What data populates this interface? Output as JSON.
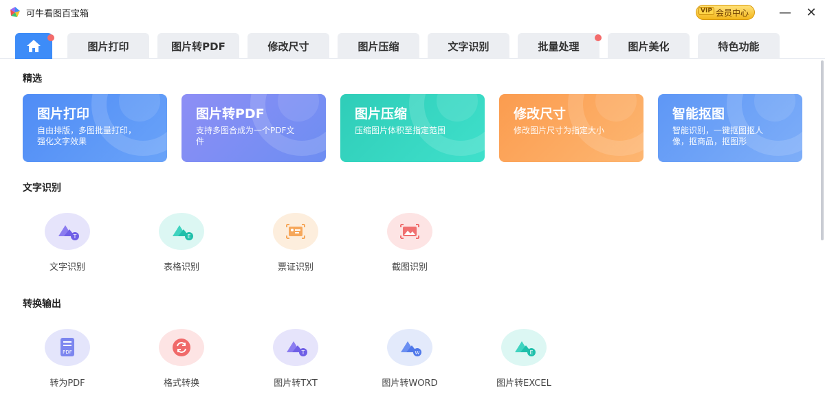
{
  "app": {
    "title": "可牛看图百宝箱",
    "vip_label": "会员中心",
    "vip_badge": "VIP"
  },
  "window": {
    "minimize": "—",
    "close": "✕"
  },
  "tabs": [
    {
      "label": "",
      "icon": "home-icon",
      "active": true,
      "dot": true
    },
    {
      "label": "图片打印"
    },
    {
      "label": "图片转PDF"
    },
    {
      "label": "修改尺寸"
    },
    {
      "label": "图片压缩"
    },
    {
      "label": "文字识别"
    },
    {
      "label": "批量处理",
      "dot": true
    },
    {
      "label": "图片美化"
    },
    {
      "label": "特色功能"
    }
  ],
  "featured": {
    "title": "精选",
    "cards": [
      {
        "title": "图片打印",
        "desc": "自由排版，多图批量打印，强化文字效果",
        "color": "#5e96f6"
      },
      {
        "title": "图片转PDF",
        "desc": "支持多图合成为一个PDF文件",
        "color": "#7b8ff3"
      },
      {
        "title": "图片压缩",
        "desc": "压缩图片体积至指定范围",
        "color": "#34d3c0"
      },
      {
        "title": "修改尺寸",
        "desc": "修改图片尺寸为指定大小",
        "color": "#fba35b"
      },
      {
        "title": "智能抠图",
        "desc": "智能识别，一键抠图抠人像，抠商品，抠图形",
        "color": "#6ea2f7"
      }
    ]
  },
  "ocr": {
    "title": "文字识别",
    "items": [
      {
        "label": "文字识别",
        "icon": "text-ocr-icon"
      },
      {
        "label": "表格识别",
        "icon": "table-ocr-icon"
      },
      {
        "label": "票证识别",
        "icon": "id-card-ocr-icon"
      },
      {
        "label": "截图识别",
        "icon": "screenshot-ocr-icon"
      }
    ]
  },
  "convert": {
    "title": "转换输出",
    "items": [
      {
        "label": "转为PDF",
        "icon": "pdf-file-icon",
        "badge": "PDF"
      },
      {
        "label": "格式转换",
        "icon": "format-convert-icon"
      },
      {
        "label": "图片转TXT",
        "icon": "txt-convert-icon"
      },
      {
        "label": "图片转WORD",
        "icon": "word-convert-icon"
      },
      {
        "label": "图片转EXCEL",
        "icon": "excel-convert-icon"
      }
    ]
  }
}
